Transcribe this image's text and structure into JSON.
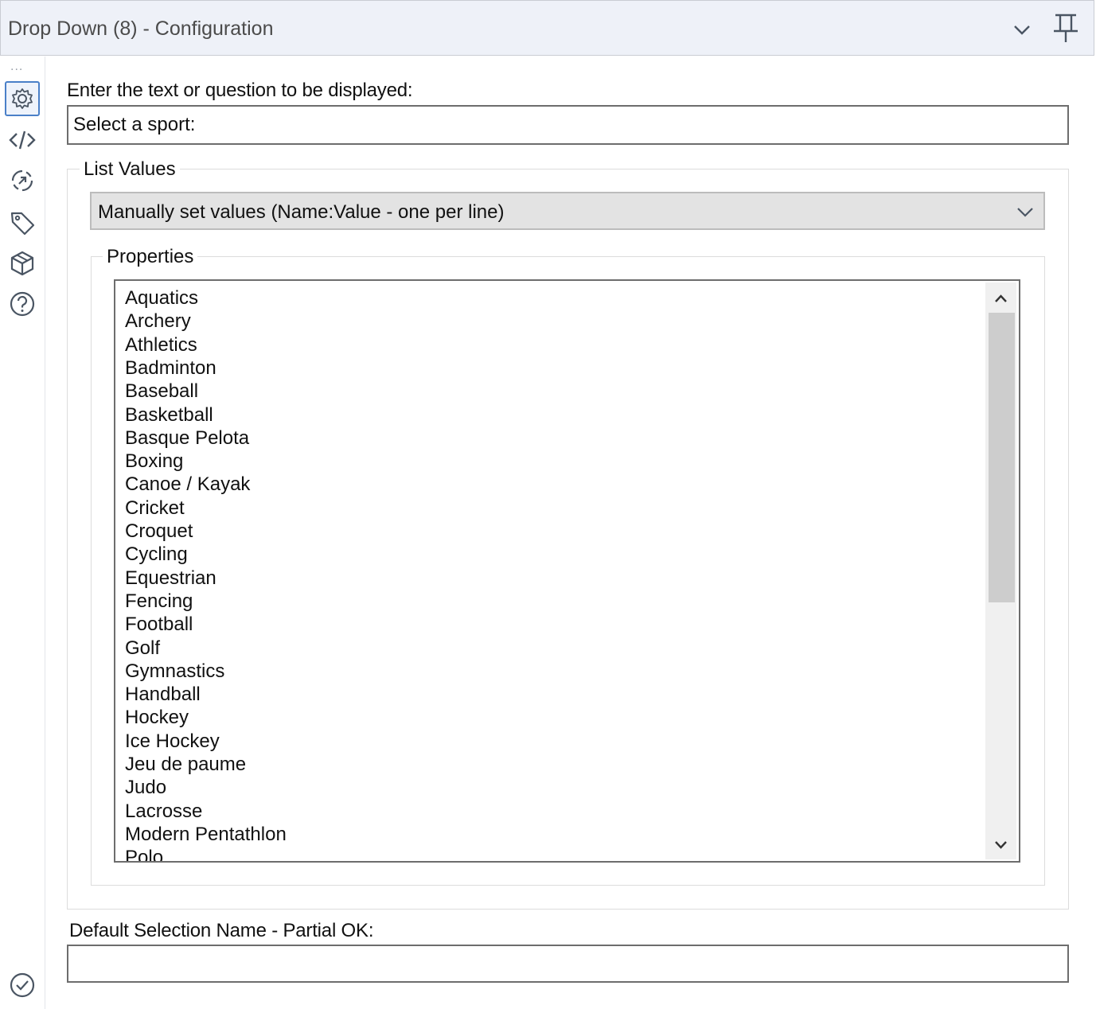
{
  "header": {
    "title": "Drop Down (8) - Configuration",
    "chevron_icon": "chevron-down-icon",
    "pin_icon": "pin-icon"
  },
  "sidebar": {
    "more": "...",
    "items": [
      {
        "icon": "gear-icon",
        "active": true
      },
      {
        "icon": "code-icon"
      },
      {
        "icon": "target-icon"
      },
      {
        "icon": "tag-icon"
      },
      {
        "icon": "cube-icon"
      },
      {
        "icon": "help-icon"
      }
    ],
    "bottom_icon": "check-circle-icon"
  },
  "form": {
    "question_label": "Enter the text or question to be displayed:",
    "question_value": "Select a sport:",
    "list_values_legend": "List Values",
    "list_values_mode": "Manually set values (Name:Value - one per line)",
    "properties_legend": "Properties",
    "properties_items": [
      "Aquatics",
      "Archery",
      "Athletics",
      "Badminton",
      "Baseball",
      "Basketball",
      "Basque Pelota",
      "Boxing",
      "Canoe / Kayak",
      "Cricket",
      "Croquet",
      "Cycling",
      "Equestrian",
      "Fencing",
      "Football",
      "Golf",
      "Gymnastics",
      "Handball",
      "Hockey",
      "Ice Hockey",
      "Jeu de paume",
      "Judo",
      "Lacrosse",
      "Modern Pentathlon",
      "Polo"
    ],
    "default_label": "Default Selection Name - Partial OK:",
    "default_value": ""
  },
  "colors": {
    "header_bg": "#eef1f8",
    "active_icon_border": "#4a80c8",
    "icon_stroke": "#4a5563"
  }
}
